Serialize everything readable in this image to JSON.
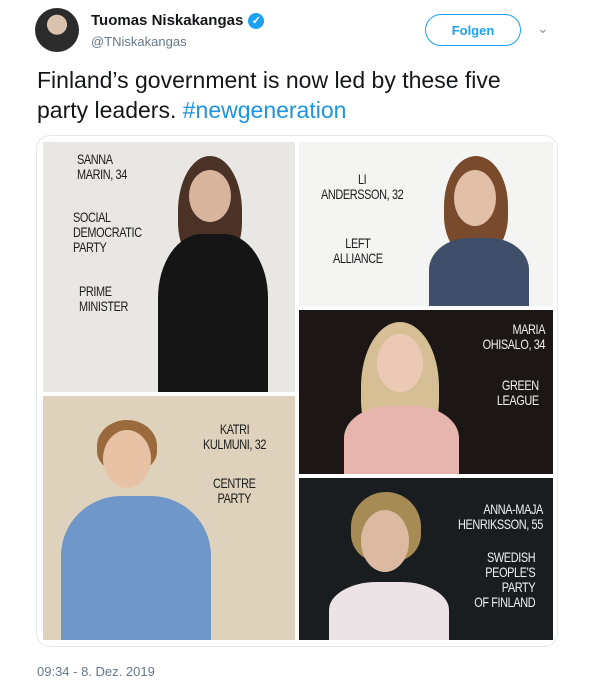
{
  "author": {
    "name": "Tuomas Niskakangas",
    "handle": "@TNiskakangas",
    "verified_icon": "verified-badge-icon"
  },
  "follow_label": "Folgen",
  "tweet": {
    "text": "Finland’s government is now led by these five party leaders.",
    "hashtag": "#newgeneration"
  },
  "image_captions": {
    "marin": {
      "name": "SANNA\nMARIN, 34",
      "party": "SOCIAL\nDEMOCRATIC\nPARTY",
      "role": "PRIME\nMINISTER"
    },
    "andersson": {
      "name": "LI\nANDERSSON, 32",
      "party": "LEFT\nALLIANCE"
    },
    "ohisalo": {
      "name": "MARIA\nOHISALO, 34",
      "party": "GREEN\nLEAGUE"
    },
    "kulmuni": {
      "name": "KATRI\nKULMUNI, 32",
      "party": "CENTRE\nPARTY"
    },
    "henriksson": {
      "name": "ANNA-MAJA\nHENRIKSSON, 55",
      "party": "SWEDISH\nPEOPLE'S\nPARTY\nOF FINLAND"
    }
  },
  "timestamp": "09:34 - 8. Dez. 2019"
}
